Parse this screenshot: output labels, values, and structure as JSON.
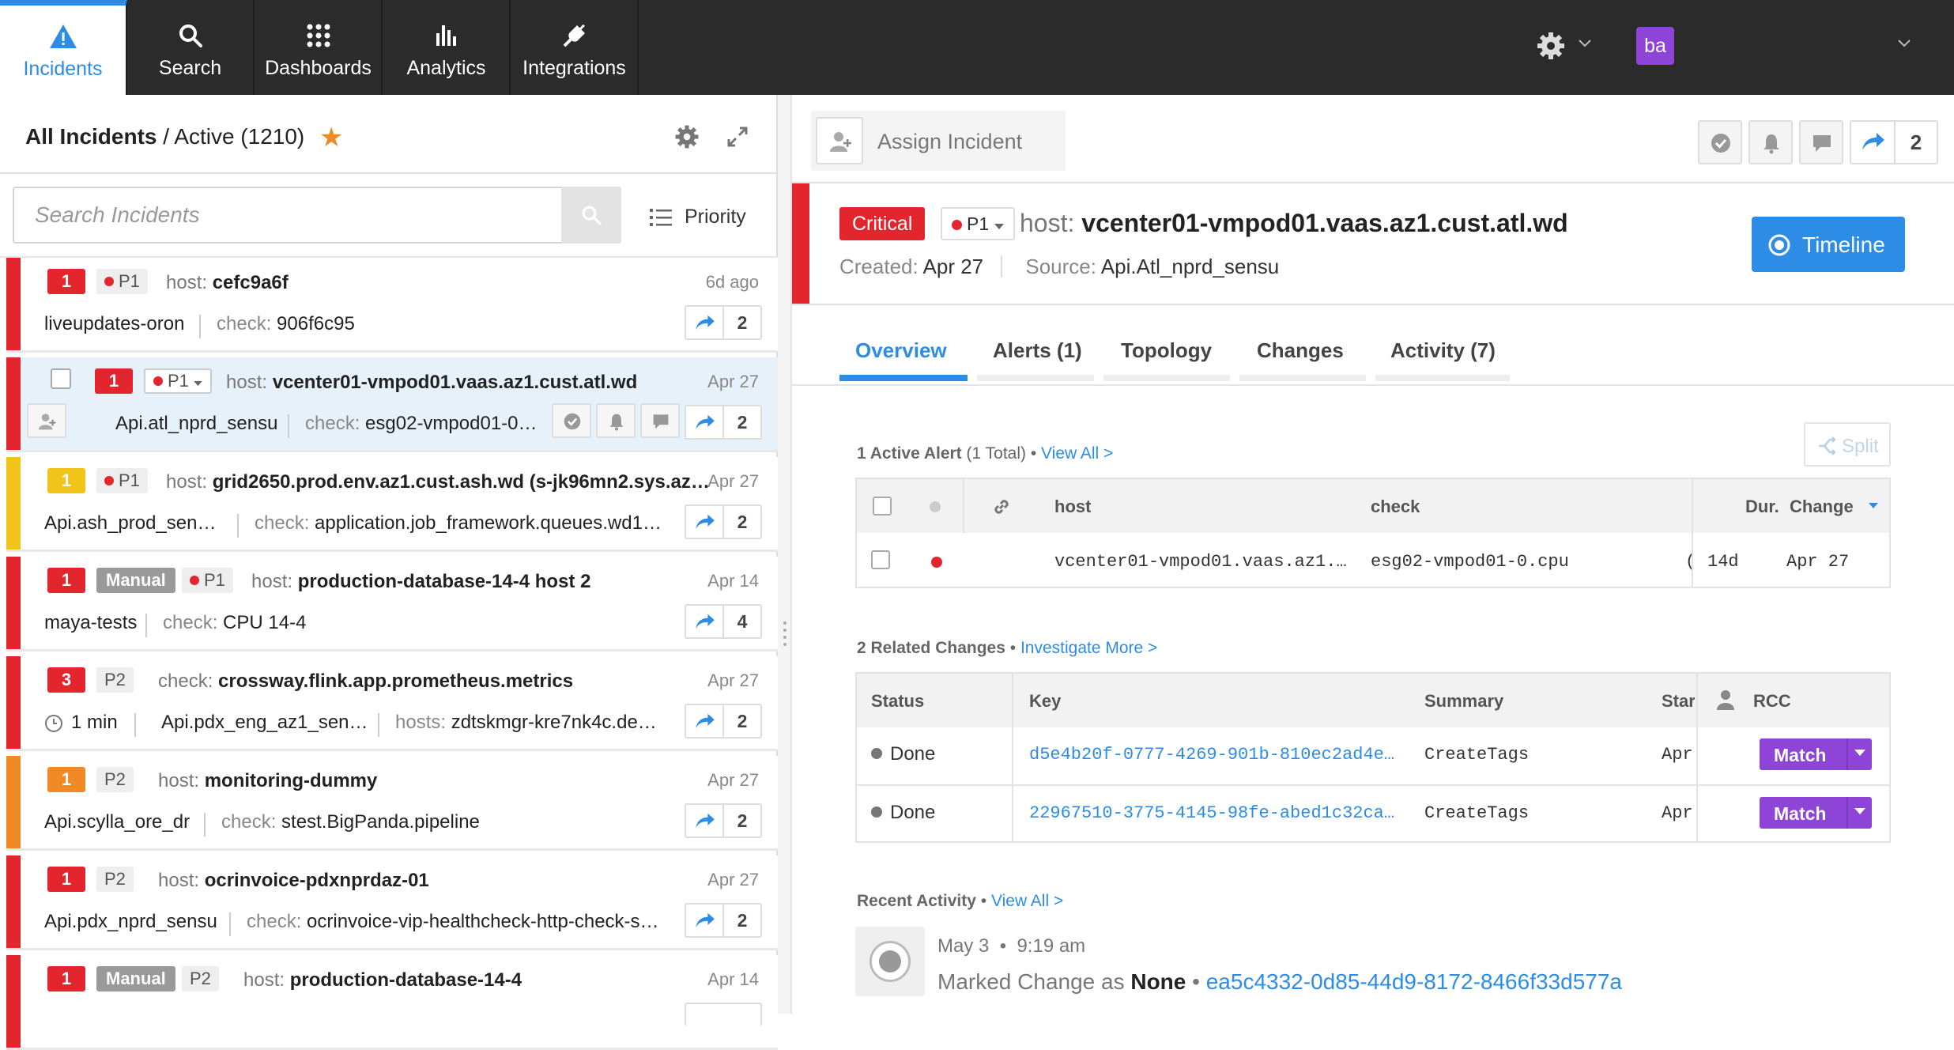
{
  "nav": {
    "tabs": [
      {
        "label": "Incidents",
        "icon": "warning-icon"
      },
      {
        "label": "Search",
        "icon": "search-icon"
      },
      {
        "label": "Dashboards",
        "icon": "grid-icon"
      },
      {
        "label": "Analytics",
        "icon": "bar-chart-icon"
      },
      {
        "label": "Integrations",
        "icon": "plug-icon"
      }
    ],
    "user_initials": "ba"
  },
  "incidents_pane": {
    "title": "All Incidents",
    "separator": "/",
    "filter": "Active",
    "count": "(1210)",
    "search_placeholder": "Search Incidents",
    "sort_label": "Priority",
    "incidents": [
      {
        "count": "1",
        "severity_color": "#e3262e",
        "manual": "",
        "priority": "P1",
        "has_dot": true,
        "field": "host:",
        "value": "cefc9a6f",
        "date": "6d ago",
        "source": "liveupdates-oron",
        "sub_label": "check:",
        "sub_value": "906f6c95",
        "shares": "2",
        "duration": ""
      },
      {
        "count": "1",
        "severity_color": "#e3262e",
        "manual": "",
        "priority": "P1",
        "has_dot": true,
        "field": "host:",
        "value": "vcenter01-vmpod01.vaas.az1.cust.atl.wd",
        "date": "Apr 27",
        "source": "Api.atl_nprd_sensu",
        "sub_label": "check:",
        "sub_value": "esg02-vmpod01-0.cpu",
        "shares": "2",
        "duration": ""
      },
      {
        "count": "1",
        "severity_color": "#f0c419",
        "manual": "",
        "priority": "P1",
        "has_dot": true,
        "field": "host:",
        "value": "grid2650.prod.env.az1.cust.ash.wd (s-jk96mn2.sys.az…",
        "date": "Apr 27",
        "source": "Api.ash_prod_sen…",
        "sub_label": "check:",
        "sub_value": "application.job_framework.queues.wd1a…",
        "shares": "2",
        "duration": ""
      },
      {
        "count": "1",
        "severity_color": "#e3262e",
        "manual": "Manual",
        "priority": "P1",
        "has_dot": true,
        "field": "host:",
        "value": "production-database-14-4 host 2",
        "date": "Apr 14",
        "source": "maya-tests",
        "sub_label": "check:",
        "sub_value": "CPU 14-4",
        "shares": "4",
        "duration": ""
      },
      {
        "count": "3",
        "severity_color": "#e3262e",
        "manual": "",
        "priority": "P2",
        "has_dot": false,
        "field": "check:",
        "value": "crossway.flink.app.prometheus.metrics",
        "date": "Apr 27",
        "source": "Api.pdx_eng_az1_sen…",
        "sub_label": "hosts:",
        "sub_value": "zdtskmgr-kre7nk4c.dev-z…",
        "shares": "2",
        "duration": "1 min"
      },
      {
        "count": "1",
        "severity_color": "#f08a24",
        "manual": "",
        "priority": "P2",
        "has_dot": false,
        "field": "host:",
        "value": "monitoring-dummy",
        "date": "Apr 27",
        "source": "Api.scylla_ore_dr",
        "sub_label": "check:",
        "sub_value": "stest.BigPanda.pipeline",
        "shares": "2",
        "duration": ""
      },
      {
        "count": "1",
        "severity_color": "#e3262e",
        "manual": "",
        "priority": "P2",
        "has_dot": false,
        "field": "host:",
        "value": "ocrinvoice-pdxnprdaz-01",
        "date": "Apr 27",
        "source": "Api.pdx_nprd_sensu",
        "sub_label": "check:",
        "sub_value": "ocrinvoice-vip-healthcheck-http-check-s…",
        "shares": "2",
        "duration": ""
      },
      {
        "count": "1",
        "severity_color": "#e3262e",
        "manual": "Manual",
        "priority": "P2",
        "has_dot": false,
        "field": "host:",
        "value": "production-database-14-4",
        "date": "Apr 14",
        "source": "",
        "sub_label": "",
        "sub_value": "",
        "shares": "",
        "duration": ""
      }
    ]
  },
  "detail": {
    "assign_label": "Assign Incident",
    "share_count": "2",
    "severity": "Critical",
    "priority": "P1",
    "title_label": "host:",
    "title_value": "vcenter01-vmpod01.vaas.az1.cust.atl.wd",
    "created_label": "Created:",
    "created_value": "Apr 27",
    "source_label": "Source:",
    "source_value": "Api.Atl_nprd_sensu",
    "timeline_label": "Timeline",
    "tabs": [
      "Overview",
      "Alerts (1)",
      "Topology",
      "Changes",
      "Activity (7)"
    ],
    "alerts_section": {
      "title": "1 Active Alert",
      "subtitle": "(1 Total)",
      "link": "View All >",
      "split_label": "Split"
    },
    "alerts_table": {
      "headers": [
        "host",
        "check",
        "Dur.",
        "Change"
      ],
      "rows": [
        {
          "host": "vcenter01-vmpod01.vaas.az1.…",
          "check": "esg02-vmpod01-0.cpu",
          "extra": "(",
          "duration": "14d",
          "change": "Apr 27"
        }
      ]
    },
    "changes_section": {
      "title": "2 Related Changes",
      "link": "Investigate More >"
    },
    "changes_table": {
      "headers": [
        "Status",
        "Key",
        "Summary",
        "Star",
        "RCC"
      ],
      "rows": [
        {
          "status": "Done",
          "key": "d5e4b20f-0777-4269-901b-810ec2ad4e…",
          "summary": "CreateTags",
          "start": "Apr",
          "rcc": "Match"
        },
        {
          "status": "Done",
          "key": "22967510-3775-4145-98fe-abed1c32ca…",
          "summary": "CreateTags",
          "start": "Apr",
          "rcc": "Match"
        }
      ]
    },
    "activity_section": {
      "title": "Recent Activity",
      "link": "View All >"
    },
    "activity": {
      "date": "May 3",
      "time": "9:19 am",
      "text_prefix": "Marked Change as",
      "text_value": "None",
      "link": "ea5c4332-0d85-44d9-8172-8466f33d577a"
    }
  }
}
